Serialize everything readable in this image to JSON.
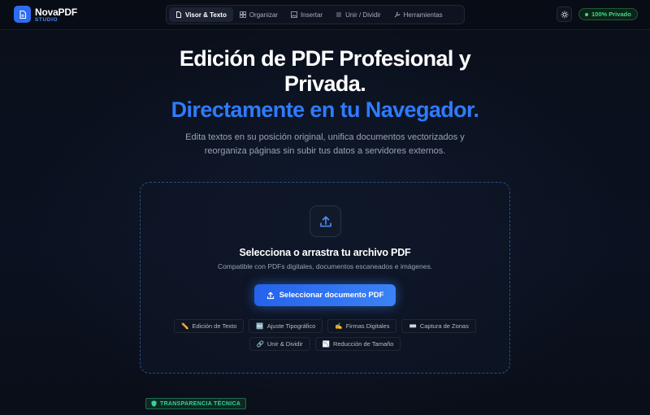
{
  "header": {
    "brand_name": "NovaPDF",
    "brand_sub": "STUDIO",
    "nav": [
      {
        "label": "Visor & Texto",
        "icon": "file-icon",
        "active": true
      },
      {
        "label": "Organizar",
        "icon": "grid-icon",
        "active": false
      },
      {
        "label": "Insertar",
        "icon": "image-icon",
        "active": false
      },
      {
        "label": "Unir / Dividir",
        "icon": "merge-icon",
        "active": false
      },
      {
        "label": "Herramientas",
        "icon": "wrench-icon",
        "active": false
      }
    ],
    "privacy_badge": "100% Privado"
  },
  "hero": {
    "title_line1": "Edición de PDF Profesional y",
    "title_line2": "Privada.",
    "accent": "Directamente en tu Navegador.",
    "description": "Edita textos en su posición original, unifica documentos vectorizados y reorganiza páginas sin subir tus datos a servidores externos."
  },
  "dropzone": {
    "title": "Selecciona o arrastra tu archivo PDF",
    "subtitle": "Compatible con PDFs digitales, documentos escaneados e imágenes.",
    "button_label": "Seleccionar documento PDF",
    "features_row1": [
      {
        "icon": "✏️",
        "label": "Edición de Texto"
      },
      {
        "icon": "🔤",
        "label": "Ajuste Tipográfico"
      },
      {
        "icon": "✍️",
        "label": "Firmas Digitales"
      },
      {
        "icon": "⌨️",
        "label": "Captura de Zonas"
      }
    ],
    "features_row2": [
      {
        "icon": "🔗",
        "label": "Unir & Dividir"
      },
      {
        "icon": "📉",
        "label": "Reducción de Tamaño"
      }
    ]
  },
  "transparency_badge": "TRANSPARENCIA TÉCNICA",
  "colors": {
    "accent": "#2f7bff",
    "privacy_green": "#3ddc84",
    "background": "#0b1120"
  }
}
